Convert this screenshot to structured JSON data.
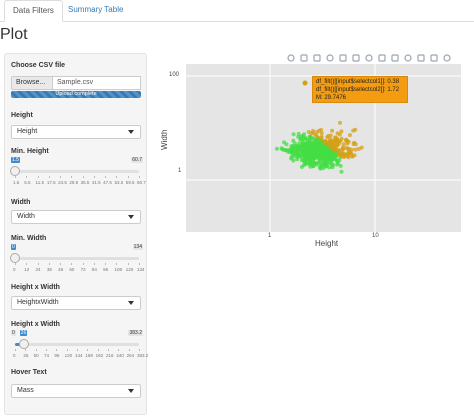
{
  "tabs": [
    {
      "label": "Data Filters",
      "active": true
    },
    {
      "label": "Summary Table",
      "active": false
    }
  ],
  "page_title": "Plot",
  "sidebar": {
    "csv": {
      "label": "Choose CSV file",
      "browse_label": "Browse...",
      "file_name": "Sample.csv",
      "upload_status": "Upload complete",
      "progress": 1.0
    },
    "height_select": {
      "label": "Height",
      "value": "Height"
    },
    "min_height": {
      "label": "Min. Height",
      "min": "1.5",
      "max": "60.7",
      "value": "1.5",
      "ticks": [
        "1.5",
        "5.5",
        "11.5",
        "17.5",
        "23.5",
        "29.5",
        "35.5",
        "41.5",
        "47.5",
        "53.5",
        "59.5",
        "60.7"
      ],
      "fraction": 0.0
    },
    "width_select": {
      "label": "Width",
      "value": "Width"
    },
    "min_width": {
      "label": "Min. Width",
      "min": "0",
      "max": "134",
      "value": "0",
      "ticks": [
        "0",
        "12",
        "24",
        "36",
        "48",
        "60",
        "72",
        "84",
        "96",
        "108",
        "120",
        "134"
      ],
      "fraction": 0.0
    },
    "hxw_select": {
      "label": "Height x Width",
      "value": "HeightxWidth"
    },
    "hxw_slider": {
      "label": "Height x Width",
      "min": "0",
      "max": "383.2",
      "value": "26",
      "ticks": [
        "0",
        "26",
        "50",
        "74",
        "96",
        "120",
        "144",
        "168",
        "192",
        "216",
        "240",
        "264",
        "383.2"
      ],
      "fraction": 0.07
    },
    "hover_select": {
      "label": "Hover Text",
      "value": "Mass"
    }
  },
  "modebar": [
    "camera-icon",
    "zoom-icon",
    "pan-icon",
    "box-select-icon",
    "lasso-icon",
    "zoom-in-icon",
    "zoom-out-icon",
    "autoscale-icon",
    "home-icon",
    "spike-icon",
    "hover-closest-icon",
    "hover-compare-icon",
    "plotly-logo-icon"
  ],
  "chart_data": {
    "type": "scatter",
    "xlabel": "Height",
    "ylabel": "Width",
    "x_scale": "log",
    "y_scale": "log",
    "x_ticks": [
      "1",
      "10"
    ],
    "y_ticks": [
      "100",
      "1"
    ],
    "colors": {
      "selected": "#d4a017",
      "unselected": "#44dd44"
    },
    "series_note": "points colored by selection",
    "tooltip_lines": [
      "df_filt()[[input$selectcol1]]: 0.38",
      "df_filt()[[input$selectcol2]]: 1.72",
      "M: 29.7476"
    ]
  }
}
